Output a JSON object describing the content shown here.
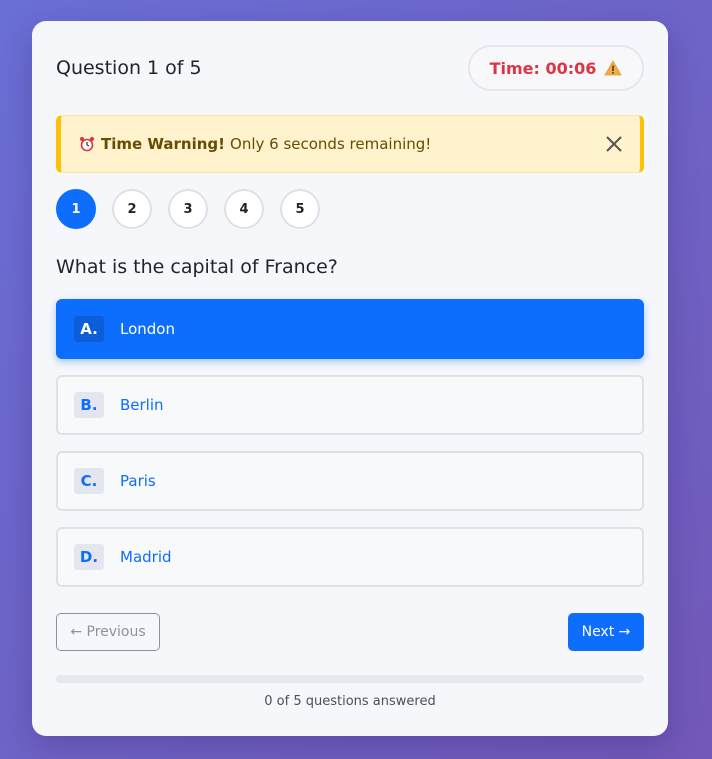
{
  "header": {
    "question_counter": "Question 1 of 5",
    "timer": "Time: 00:06",
    "timer_icon": "warning-triangle-icon"
  },
  "alert": {
    "icon": "alarm-clock-icon",
    "title": "Time Warning!",
    "message": "Only 6 seconds remaining!",
    "close_icon": "close-icon"
  },
  "steps": [
    "1",
    "2",
    "3",
    "4",
    "5"
  ],
  "active_step": 0,
  "question": "What is the capital of France?",
  "options": [
    {
      "letter": "A.",
      "text": "London",
      "selected": true
    },
    {
      "letter": "B.",
      "text": "Berlin",
      "selected": false
    },
    {
      "letter": "C.",
      "text": "Paris",
      "selected": false
    },
    {
      "letter": "D.",
      "text": "Madrid",
      "selected": false
    }
  ],
  "nav": {
    "previous_label": "← Previous",
    "next_label": "Next →"
  },
  "progress": {
    "answered_fraction": 0,
    "label": "0 of 5 questions answered"
  },
  "colors": {
    "accent": "#0d6efd",
    "danger": "#dc3545",
    "warning": "#ffc107",
    "warning_bg": "#fff3cd"
  }
}
